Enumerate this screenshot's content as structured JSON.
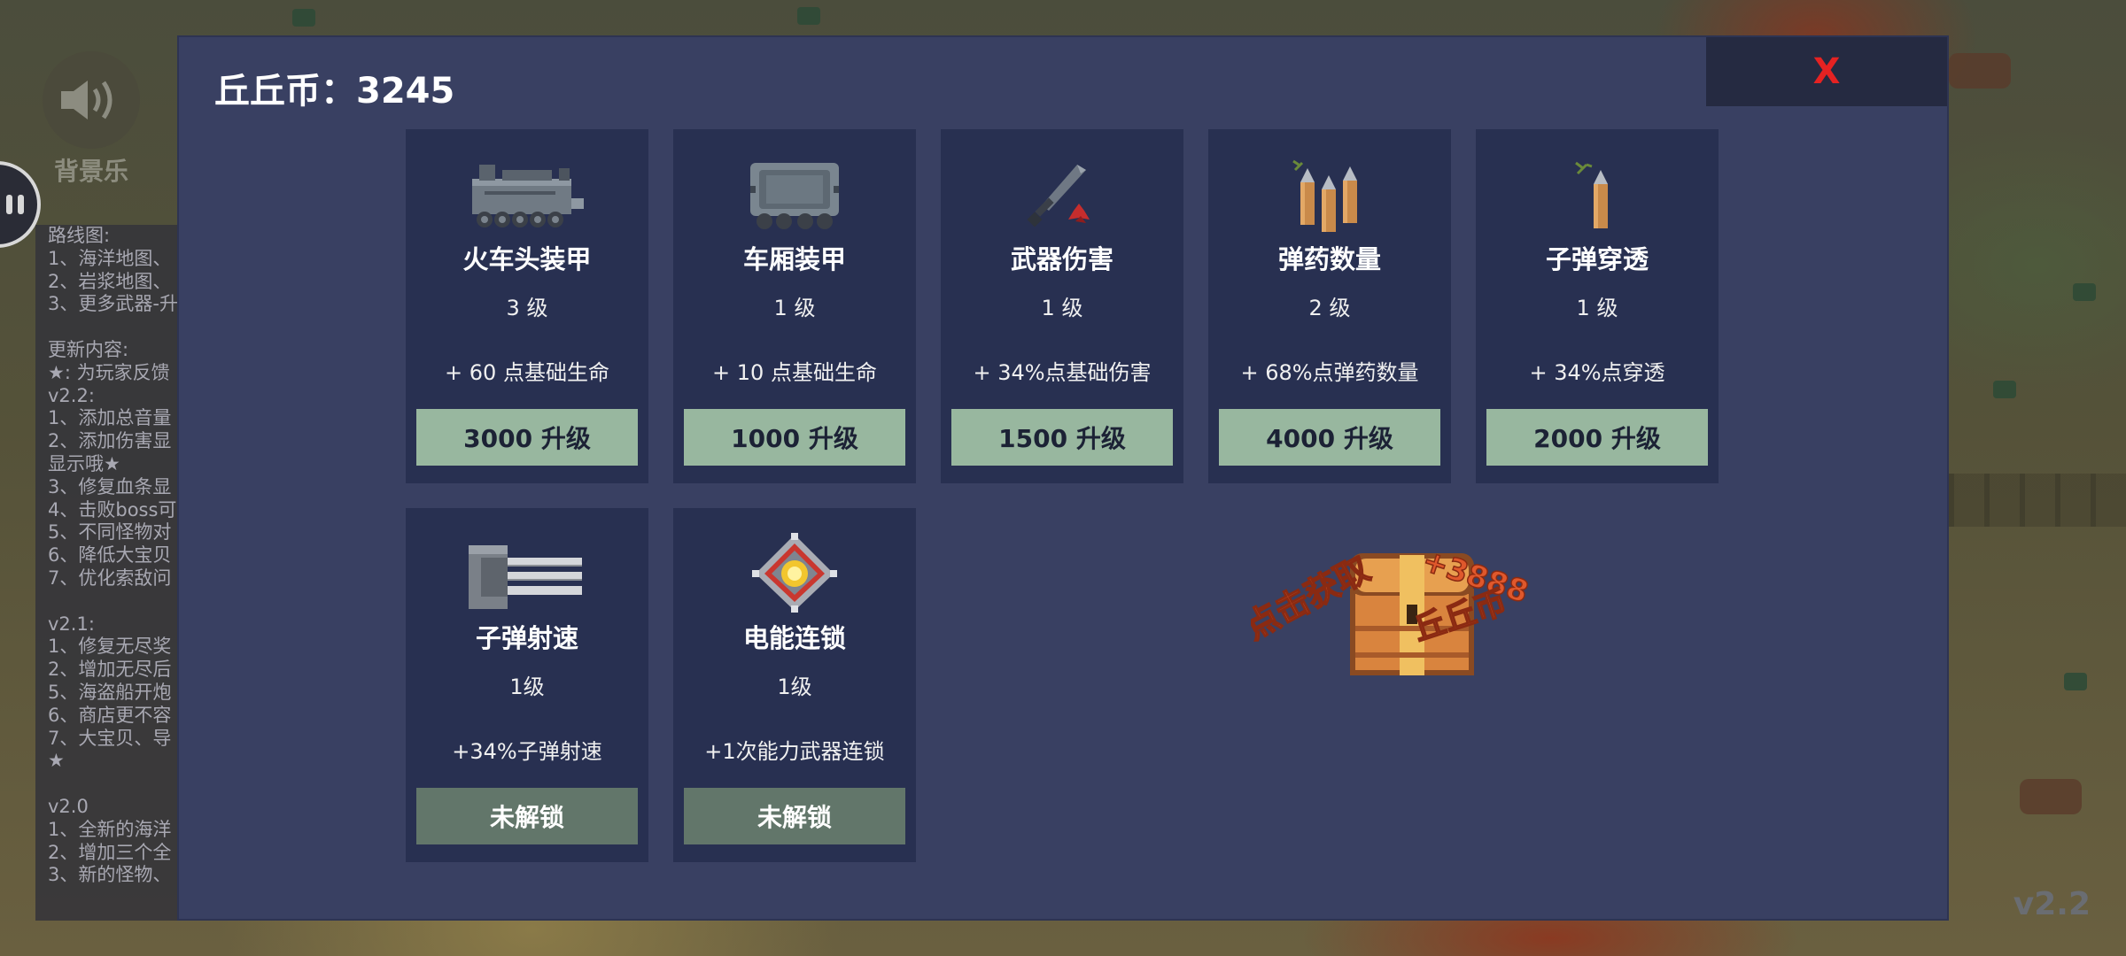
{
  "background": {
    "music_label": "背景乐",
    "music_icon": "speaker-icon",
    "version": "v2.2",
    "notes": [
      "路线图:",
      "1、海洋地图、",
      "2、岩浆地图、",
      "3、更多武器-升",
      "",
      "更新内容:",
      "★: 为玩家反馈",
      "v2.2:",
      "1、添加总音量",
      "2、添加伤害显",
      "显示哦★",
      "3、修复血条显",
      "4、击败boss可",
      "5、不同怪物对",
      "6、降低大宝贝",
      "7、优化索敌问",
      "",
      "v2.1:",
      "1、修复无尽奖",
      "2、增加无尽后",
      "5、海盗船开炮",
      "6、商店更不容",
      "7、大宝贝、导",
      "★",
      "",
      "v2.0",
      "1、全新的海洋",
      "2、增加三个全",
      "3、新的怪物、"
    ]
  },
  "dialog": {
    "coin_label": "丘丘币：3245",
    "close_label": "X",
    "close_color": "#e52222",
    "upgrades": [
      {
        "icon": "locomotive-icon",
        "name": "火车头装甲",
        "level": "3 级",
        "effect": "+ 60 点基础生命",
        "button": "3000 升级",
        "state": "upgrade"
      },
      {
        "icon": "train-car-icon",
        "name": "车厢装甲",
        "level": "1 级",
        "effect": "+ 10 点基础生命",
        "button": "1000 升级",
        "state": "upgrade"
      },
      {
        "icon": "sword-icon",
        "name": "武器伤害",
        "level": "1 级",
        "effect": "+ 34%点基础伤害",
        "button": "1500 升级",
        "state": "upgrade"
      },
      {
        "icon": "ammo-icon",
        "name": "弹药数量",
        "level": "2 级",
        "effect": "+ 68%点弹药数量",
        "button": "4000 升级",
        "state": "upgrade"
      },
      {
        "icon": "bullet-icon",
        "name": "子弹穿透",
        "level": "1 级",
        "effect": "+ 34%点穿透",
        "button": "2000 升级",
        "state": "upgrade"
      },
      {
        "icon": "gun-barrel-icon",
        "name": "子弹射速",
        "level": "1级",
        "effect": "+34%子弹射速",
        "button": "未解锁",
        "state": "locked"
      },
      {
        "icon": "energy-core-icon",
        "name": "电能连锁",
        "level": "1级",
        "effect": "+1次能力武器连锁",
        "button": "未解锁",
        "state": "locked"
      }
    ],
    "chest": {
      "icon": "treasure-chest-icon",
      "left_text": "点击获取",
      "right_text_1": "+3888",
      "right_text_2": "丘丘币"
    }
  },
  "colors": {
    "dialog_bg": "#394062",
    "card_bg": "#283051",
    "upgrade_button": "#98b79f",
    "locked_button": "#62766a",
    "chest_text": "#e0582c"
  }
}
